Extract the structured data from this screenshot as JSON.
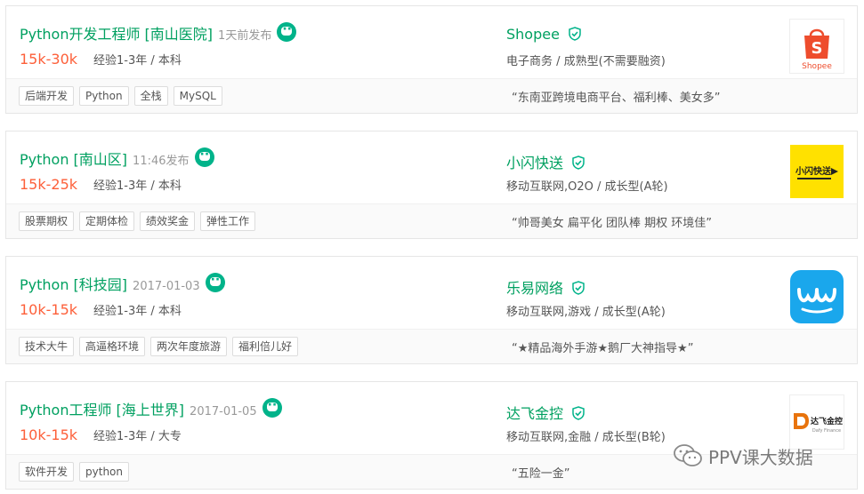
{
  "jobs": [
    {
      "title": "Python开发工程师 [南山医院]",
      "pub_time": "1天前发布",
      "salary": "15k-30k",
      "requirements": "经验1-3年 / 本科",
      "company": "Shopee",
      "industry": "电子商务 / 成熟型(不需要融资)",
      "tags": [
        "后端开发",
        "Python",
        "全栈",
        "MySQL"
      ],
      "slogan": "“东南亚跨境电商平台、福利棒、美女多”",
      "logo_text": "Shopee"
    },
    {
      "title": "Python [南山区]",
      "pub_time": "11:46发布",
      "salary": "15k-25k",
      "requirements": "经验1-3年 / 本科",
      "company": "小闪快送",
      "industry": "移动互联网,O2O / 成长型(A轮)",
      "tags": [
        "股票期权",
        "定期体检",
        "绩效奖金",
        "弹性工作"
      ],
      "slogan": "“帅哥美女 扁平化 团队棒 期权 环境佳”",
      "logo_text": "小闪快送"
    },
    {
      "title": "Python [科技园]",
      "pub_time": "2017-01-03",
      "salary": "10k-15k",
      "requirements": "经验1-3年 / 本科",
      "company": "乐易网络",
      "industry": "移动互联网,游戏 / 成长型(A轮)",
      "tags": [
        "技术大牛",
        "高逼格环境",
        "两次年度旅游",
        "福利倍儿好"
      ],
      "slogan": "“★精品海外手游★鹅厂大神指导★”",
      "logo_text": ""
    },
    {
      "title": "Python工程师 [海上世界]",
      "pub_time": "2017-01-05",
      "salary": "10k-15k",
      "requirements": "经验1-3年 / 大专",
      "company": "达飞金控",
      "industry": "移动互联网,金融 / 成长型(B轮)",
      "tags": [
        "软件开发",
        "python"
      ],
      "slogan": "“五险一金”",
      "logo_text": "达飞金控",
      "logo_subtext": "Dafy Finance"
    }
  ],
  "watermark": "PPV课大数据",
  "colors": {
    "title_green": "#00a060",
    "salary_orange": "#fd5f39",
    "chat_green": "#00b38a"
  }
}
